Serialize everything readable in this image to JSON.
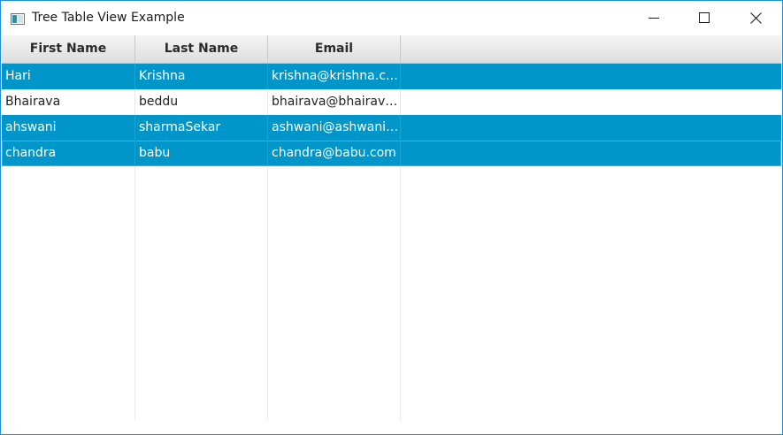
{
  "window": {
    "title": "Tree Table View Example",
    "accent": "#1f8fd8"
  },
  "table": {
    "columns": [
      "First Name",
      "Last Name",
      "Email"
    ],
    "rows": [
      {
        "first": "Hari",
        "last": "Krishna",
        "email": "krishna@krishna.com",
        "selected": true
      },
      {
        "first": "Bhairava",
        "last": "beddu",
        "email": "bhairava@bhairava....",
        "selected": false
      },
      {
        "first": "ahswani",
        "last": "sharmaSekar",
        "email": "ashwani@ashwani....",
        "selected": true
      },
      {
        "first": "chandra",
        "last": "babu",
        "email": "chandra@babu.com",
        "selected": true
      }
    ],
    "selection_color": "#0096c9"
  }
}
